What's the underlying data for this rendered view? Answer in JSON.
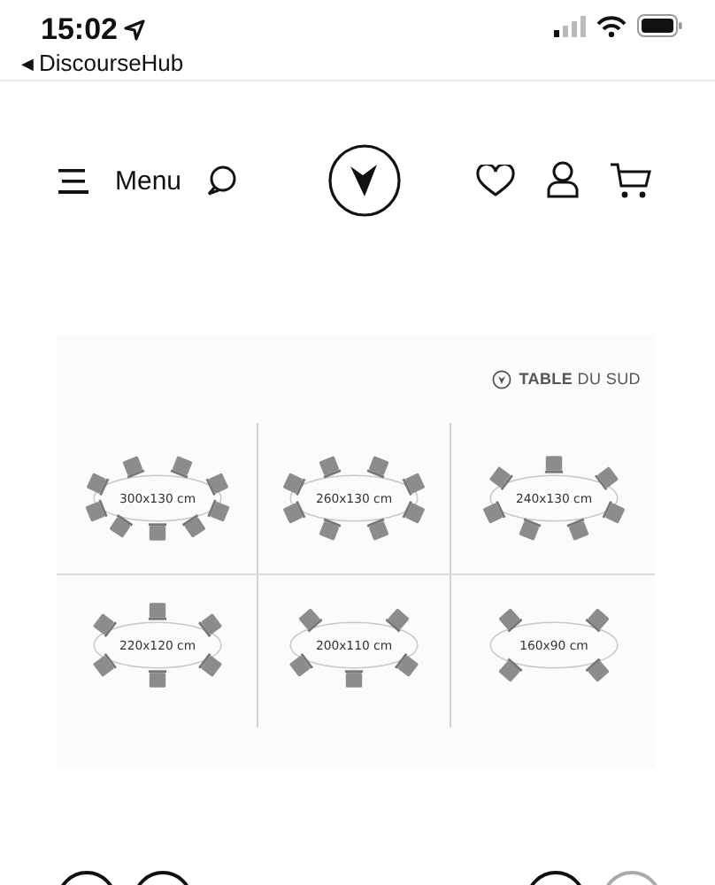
{
  "status_bar": {
    "time": "15:02",
    "back_arrow": "◀",
    "back_label": "DiscourseHub"
  },
  "header": {
    "menu_label": "Menu"
  },
  "product_image": {
    "brand": "**TABLE** DU SUD",
    "tables": [
      {
        "size": "300x130 cm",
        "top": [
          {
            "kind": "chair"
          },
          {
            "kind": "chair"
          },
          {
            "kind": "chair"
          },
          {
            "kind": "chair"
          }
        ],
        "bottom": [
          {
            "kind": "chair"
          },
          {
            "kind": "chair"
          },
          {
            "kind": "chair"
          },
          {
            "kind": "chair"
          },
          {
            "kind": "chair"
          }
        ]
      },
      {
        "size": "260x130 cm",
        "top": [
          {
            "kind": "chair"
          },
          {
            "kind": "chair"
          },
          {
            "kind": "chair"
          },
          {
            "kind": "chair"
          }
        ],
        "bottom": [
          {
            "kind": "chair"
          },
          {
            "kind": "chair"
          },
          {
            "kind": "chair"
          },
          {
            "kind": "chair"
          }
        ]
      },
      {
        "size": "240x130 cm",
        "top": [
          {
            "kind": "chair"
          },
          {
            "kind": "chair"
          },
          {
            "kind": "chair"
          }
        ],
        "bottom": [
          {
            "kind": "chair"
          },
          {
            "kind": "chair"
          },
          {
            "kind": "chair"
          },
          {
            "kind": "chair"
          }
        ]
      },
      {
        "size": "220x120 cm",
        "top": [
          {
            "kind": "chair"
          },
          {
            "kind": "chair"
          },
          {
            "kind": "chair"
          }
        ],
        "bottom": [
          {
            "kind": "chair"
          },
          {
            "kind": "chair"
          },
          {
            "kind": "chair"
          }
        ]
      },
      {
        "size": "200x110 cm",
        "top": [
          {
            "kind": "chair"
          },
          {
            "kind": "chair"
          }
        ],
        "bottom": [
          {
            "kind": "chair"
          },
          {
            "kind": "chair"
          },
          {
            "kind": "chair"
          }
        ]
      },
      {
        "size": "160x90 cm",
        "top": [
          {
            "kind": "chair"
          },
          {
            "kind": "chair"
          }
        ],
        "bottom": [
          {
            "kind": "chair"
          },
          {
            "kind": "chair"
          }
        ]
      }
    ]
  }
}
